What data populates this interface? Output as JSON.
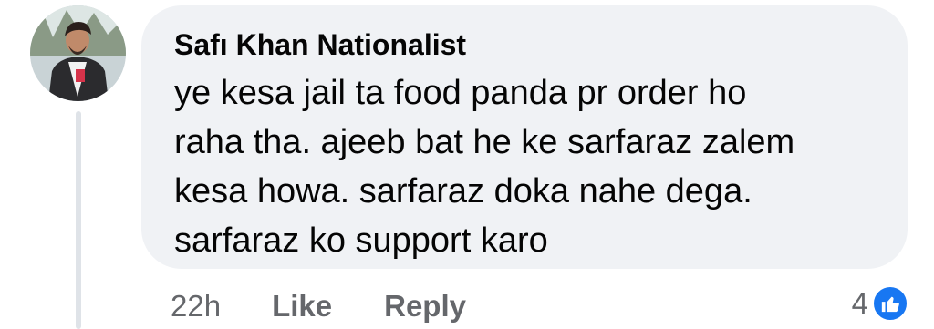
{
  "comment": {
    "author": "Safı Khan Nationalist",
    "text_lines": [
      "ye kesa jail ta food panda pr order ho",
      "raha tha. ajeeb bat he ke sarfaraz zalem",
      "kesa howa. sarfaraz doka nahe dega.",
      "sarfaraz ko support karo"
    ]
  },
  "actions": {
    "time": "22h",
    "like_label": "Like",
    "reply_label": "Reply"
  },
  "reactions": {
    "count": "4",
    "icon": "thumbs-up-icon",
    "color": "#1877f2"
  },
  "theme": {
    "bubble_bg": "#f0f2f5",
    "meta_text": "#65676b",
    "body_text": "#050505"
  }
}
